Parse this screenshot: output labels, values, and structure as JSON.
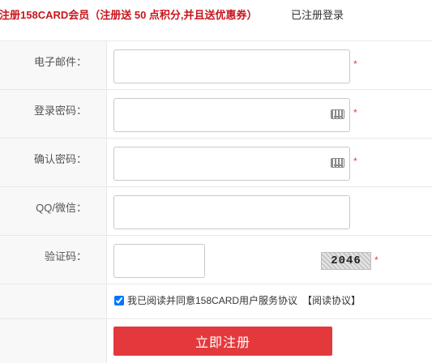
{
  "header": {
    "title": "注册158CARD会员（注册送 50 点积分,并且送优惠券）",
    "login_link": "已注册登录"
  },
  "form": {
    "email_label": "电子邮件：",
    "password_label": "登录密码：",
    "confirm_label": "确认密码：",
    "qq_label": "QQ/微信：",
    "captcha_label": "验证码：",
    "required_mark": "*",
    "captcha_text": "2046",
    "agree_text": "我已阅读并同意158CARD用户服务协议",
    "agree_link": "【阅读协议】",
    "agree_checked": true,
    "submit_label": "立即注册"
  },
  "colors": {
    "accent": "#e4393c",
    "title": "#c8161d",
    "label_bg": "#f8f8f8",
    "border": "#e8e8e8"
  }
}
